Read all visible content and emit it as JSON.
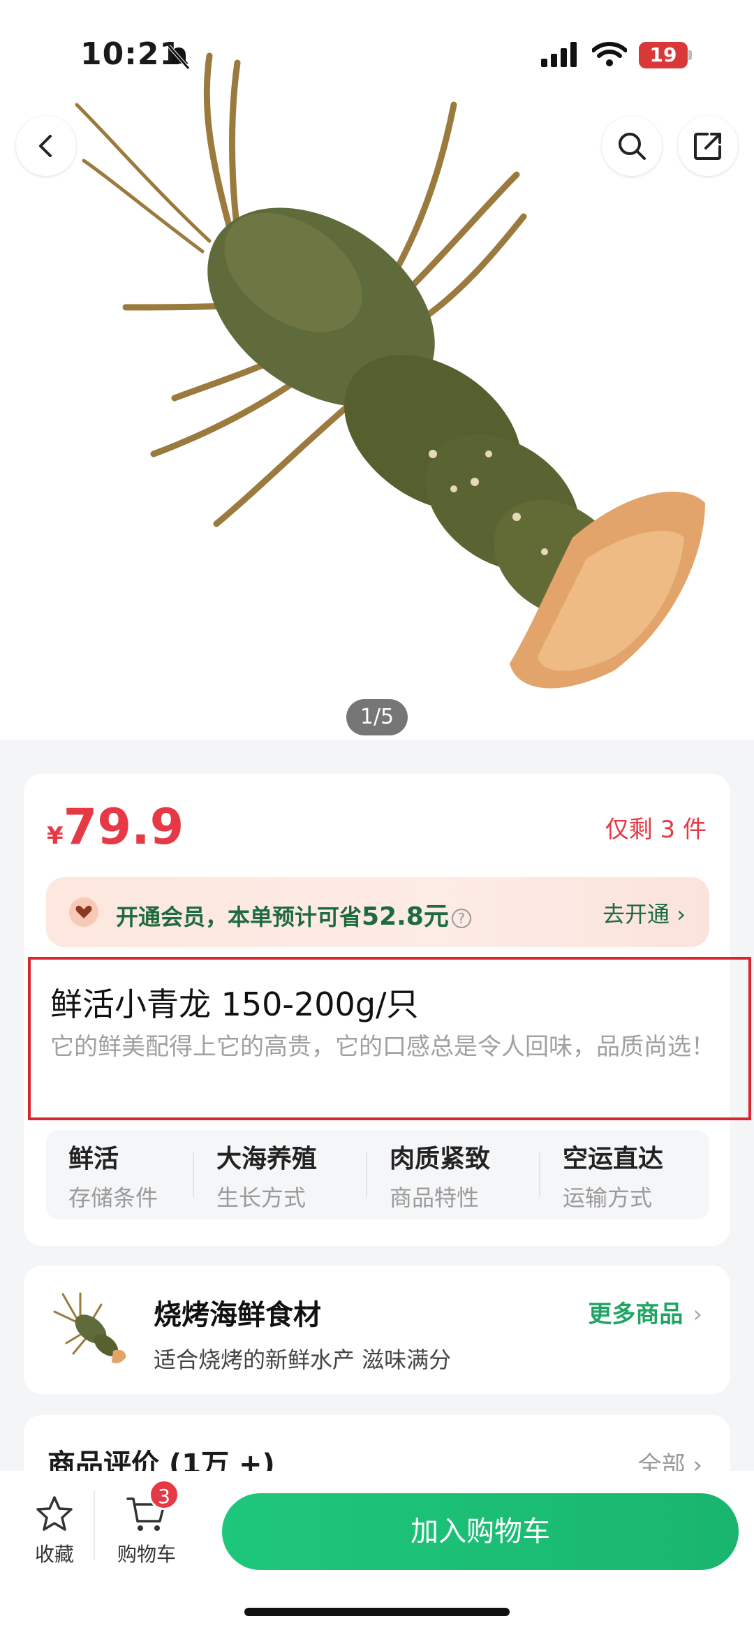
{
  "status_bar": {
    "time": "10:21",
    "battery": "19"
  },
  "gallery": {
    "pager": "1/5"
  },
  "product": {
    "currency": "¥",
    "price": "79.9",
    "stock": "仅剩 3 件",
    "vip": {
      "text": "开通会员，本单预计可省",
      "save": "52.8元",
      "help": "?",
      "cta": "去开通 ›"
    },
    "title": "鲜活小青龙 150-200g/只",
    "subtitle": "它的鲜美配得上它的高贵，它的口感总是令人回味，品质尚选！",
    "attrs": [
      {
        "value": "鲜活",
        "key": "存储条件"
      },
      {
        "value": "大海养殖",
        "key": "生长方式"
      },
      {
        "value": "肉质紧致",
        "key": "商品特性"
      },
      {
        "value": "空运直达",
        "key": "运输方式"
      }
    ]
  },
  "category": {
    "title": "烧烤海鲜食材",
    "subtitle": "适合烧烤的新鲜水产 滋味满分",
    "more": "更多商品",
    "chev": "›"
  },
  "reviews": {
    "title": "商品评价 (1万 +)",
    "all": "全部 ›"
  },
  "bottom_bar": {
    "fav": "收藏",
    "cart": "购物车",
    "cart_count": "3",
    "add": "加入购物车"
  }
}
